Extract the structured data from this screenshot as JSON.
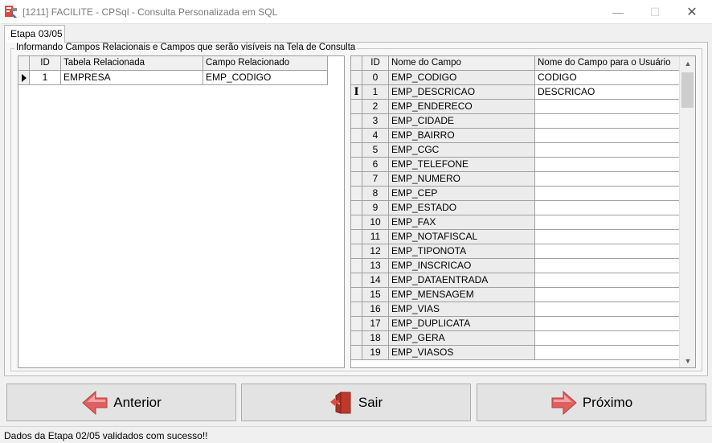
{
  "window": {
    "title": "[1211] FACILITE - CPSql - Consulta Personalizada em SQL",
    "minimize_glyph": "—",
    "maximize_glyph": "☐",
    "close_glyph": "✕"
  },
  "tab": {
    "label": "Etapa 03/05"
  },
  "group": {
    "caption": "Informando Campos Relacionais e Campos que serão visíveis na Tela de Consulta"
  },
  "left_grid": {
    "columns": [
      "ID",
      "Tabela Relacionada",
      "Campo Relacionado"
    ],
    "rows": [
      {
        "id": "1",
        "tabela": "EMPRESA",
        "campo": "EMP_CODIGO",
        "current": true
      }
    ]
  },
  "right_grid": {
    "columns": [
      "ID",
      "Nome do Campo",
      "Nome do Campo para o Usuário"
    ],
    "rows": [
      {
        "id": "0",
        "campo": "EMP_CODIGO",
        "usuario": "CODIGO"
      },
      {
        "id": "1",
        "campo": "EMP_DESCRICAO",
        "usuario": "DESCRICAO",
        "editing": true
      },
      {
        "id": "2",
        "campo": "EMP_ENDERECO",
        "usuario": ""
      },
      {
        "id": "3",
        "campo": "EMP_CIDADE",
        "usuario": ""
      },
      {
        "id": "4",
        "campo": "EMP_BAIRRO",
        "usuario": ""
      },
      {
        "id": "5",
        "campo": "EMP_CGC",
        "usuario": ""
      },
      {
        "id": "6",
        "campo": "EMP_TELEFONE",
        "usuario": ""
      },
      {
        "id": "7",
        "campo": "EMP_NUMERO",
        "usuario": ""
      },
      {
        "id": "8",
        "campo": "EMP_CEP",
        "usuario": ""
      },
      {
        "id": "9",
        "campo": "EMP_ESTADO",
        "usuario": ""
      },
      {
        "id": "10",
        "campo": "EMP_FAX",
        "usuario": ""
      },
      {
        "id": "11",
        "campo": "EMP_NOTAFISCAL",
        "usuario": ""
      },
      {
        "id": "12",
        "campo": "EMP_TIPONOTA",
        "usuario": ""
      },
      {
        "id": "13",
        "campo": "EMP_INSCRICAO",
        "usuario": ""
      },
      {
        "id": "14",
        "campo": "EMP_DATAENTRADA",
        "usuario": ""
      },
      {
        "id": "15",
        "campo": "EMP_MENSAGEM",
        "usuario": ""
      },
      {
        "id": "16",
        "campo": "EMP_VIAS",
        "usuario": ""
      },
      {
        "id": "17",
        "campo": "EMP_DUPLICATA",
        "usuario": ""
      },
      {
        "id": "18",
        "campo": "EMP_GERA",
        "usuario": ""
      },
      {
        "id": "19",
        "campo": "EMP_VIASOS",
        "usuario": ""
      }
    ]
  },
  "buttons": {
    "anterior": "Anterior",
    "sair": "Sair",
    "proximo": "Próximo"
  },
  "icons": {
    "app": "app-logo-icon",
    "anterior": "arrow-left-icon",
    "sair": "exit-door-icon",
    "proximo": "arrow-right-icon"
  },
  "colors": {
    "arrow_red": "#d9534f",
    "door_red": "#c0392b"
  },
  "status": {
    "message": "Dados da Etapa 02/05 validados com sucesso!!"
  }
}
